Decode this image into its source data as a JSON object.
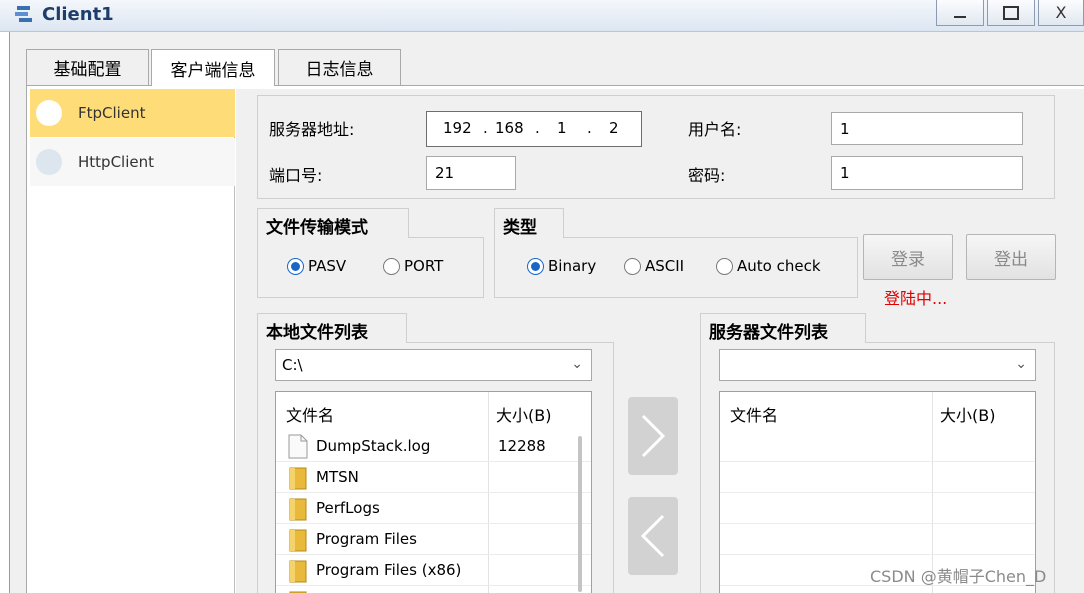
{
  "window": {
    "title": "Client1",
    "minimize": "—",
    "maximize": "☐",
    "close": "X"
  },
  "tabs": [
    {
      "label": "基础配置"
    },
    {
      "label": "客户端信息"
    },
    {
      "label": "日志信息"
    }
  ],
  "clients": [
    {
      "label": "FtpClient",
      "selected": true
    },
    {
      "label": "HttpClient",
      "selected": false
    }
  ],
  "server": {
    "address_label": "服务器地址:",
    "ip": [
      "192",
      "168",
      "1",
      "2"
    ],
    "username_label": "用户名:",
    "username": "1",
    "port_label": "端口号:",
    "port": "21",
    "password_label": "密码:",
    "password": "1"
  },
  "transfer_mode": {
    "title": "文件传输模式",
    "options": [
      {
        "label": "PASV",
        "selected": true
      },
      {
        "label": "PORT",
        "selected": false
      }
    ]
  },
  "type_group": {
    "title": "类型",
    "options": [
      {
        "label": "Binary",
        "selected": true
      },
      {
        "label": "ASCII",
        "selected": false
      },
      {
        "label": "Auto check",
        "selected": false
      }
    ]
  },
  "buttons": {
    "login": "登录",
    "logout": "登出"
  },
  "status": "登陆中...",
  "local_files": {
    "title": "本地文件列表",
    "path": "C:\\",
    "col_name": "文件名",
    "col_size": "大小(B)",
    "rows": [
      {
        "name": "DumpStack.log",
        "size": "12288",
        "icon": "file-icon"
      },
      {
        "name": "MTSN",
        "size": "",
        "icon": "folder-icon"
      },
      {
        "name": "PerfLogs",
        "size": "",
        "icon": "folder-icon"
      },
      {
        "name": "Program Files",
        "size": "",
        "icon": "folder-icon"
      },
      {
        "name": "Program Files (x86)",
        "size": "",
        "icon": "folder-icon"
      }
    ]
  },
  "server_files": {
    "title": "服务器文件列表",
    "path": "",
    "col_name": "文件名",
    "col_size": "大小(B)"
  },
  "watermark": "CSDN @黄帽子Chen_D"
}
